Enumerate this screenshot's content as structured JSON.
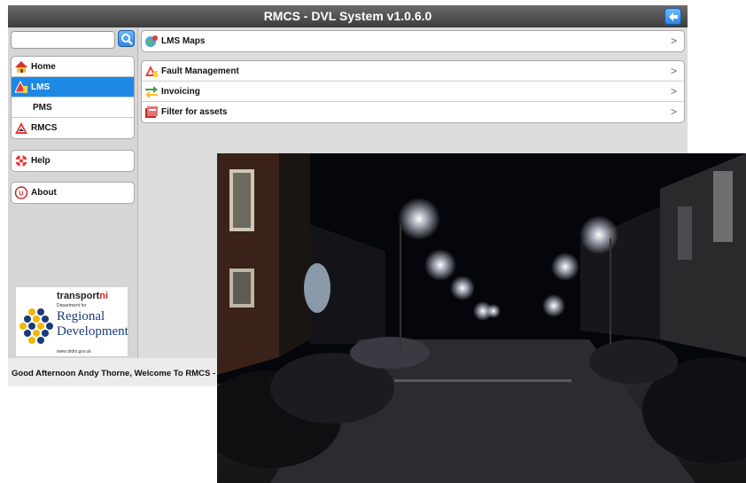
{
  "window": {
    "title": "RMCS - DVL System v1.0.6.0"
  },
  "search": {
    "placeholder": "",
    "value": ""
  },
  "sidebar": {
    "group1": [
      {
        "label": "Home",
        "icon": "home-icon"
      },
      {
        "label": "LMS",
        "icon": "warning-sign-icon",
        "selected": true
      },
      {
        "label": "PMS",
        "icon": ""
      },
      {
        "label": "RMCS",
        "icon": "warning-triangle-icon"
      }
    ],
    "help": {
      "label": "Help",
      "icon": "lifebuoy-icon"
    },
    "about": {
      "label": "About",
      "icon": "info-logo-icon"
    }
  },
  "logo": {
    "brand_prefix": "transport",
    "brand_suffix": "ni",
    "dept": "Department for",
    "name_line1": "Regional",
    "name_line2": "Development",
    "url": "www.drdni.gov.uk"
  },
  "main": {
    "top_item": {
      "label": "LMS Maps",
      "icon": "globe-map-icon"
    },
    "items": [
      {
        "label": "Fault Management",
        "icon": "warning-triangle-icon"
      },
      {
        "label": "Invoicing",
        "icon": "arrows-icon"
      },
      {
        "label": "Filter for assets",
        "icon": "filter-box-icon"
      }
    ],
    "chevron": ">"
  },
  "status": {
    "greeting": "Good Afternoon Andy Thorne, Welcome To RMCS - DVL"
  },
  "colors": {
    "accent": "#1e88e5",
    "titlebar": "#4a4a4a",
    "background": "#dcdcdc"
  }
}
